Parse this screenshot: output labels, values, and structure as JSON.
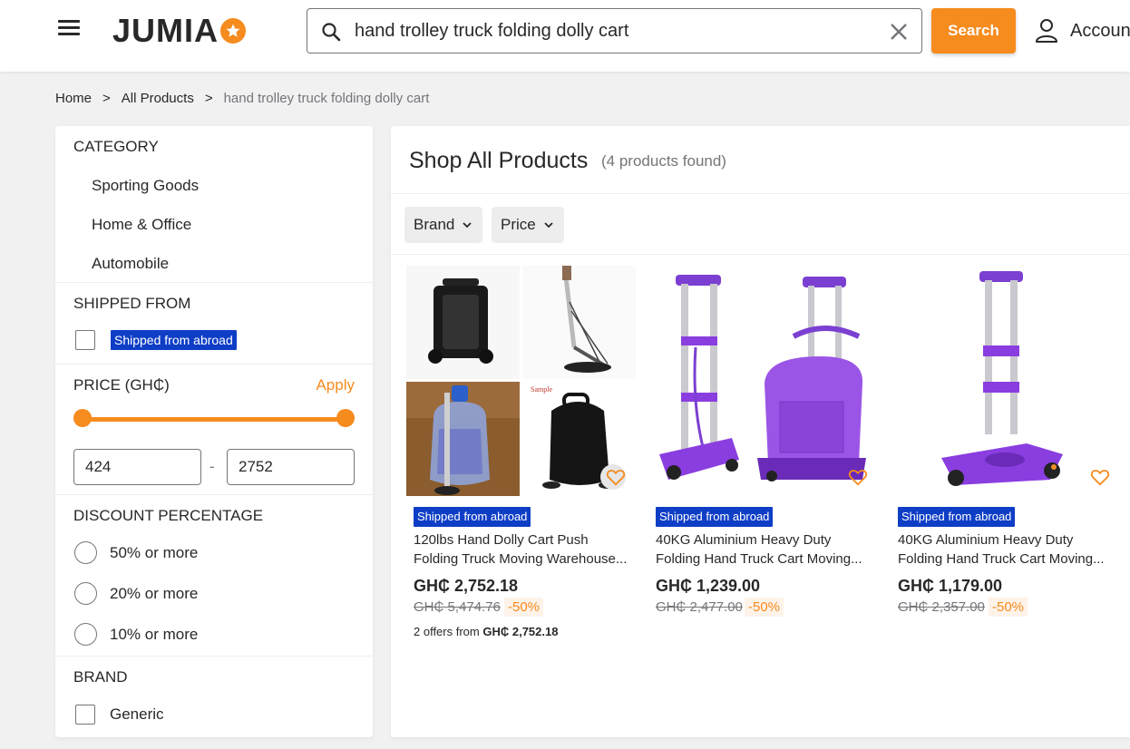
{
  "header": {
    "logo_text": "JUMIA",
    "search_value": "hand trolley truck folding dolly cart",
    "search_button": "Search",
    "account_label": "Accoun"
  },
  "breadcrumb": {
    "home": "Home",
    "all_products": "All Products",
    "current": "hand trolley truck folding dolly cart",
    "separator": ">"
  },
  "sidebar": {
    "category": {
      "title": "CATEGORY",
      "items": [
        "Sporting Goods",
        "Home & Office",
        "Automobile"
      ]
    },
    "shipped_from": {
      "title": "SHIPPED FROM",
      "option": "Shipped from abroad"
    },
    "price": {
      "title": "PRICE (GH₵)",
      "apply": "Apply",
      "min": "424",
      "max": "2752",
      "dash": "-"
    },
    "discount": {
      "title": "DISCOUNT PERCENTAGE",
      "options": [
        "50% or more",
        "20% or more",
        "10% or more"
      ]
    },
    "brand": {
      "title": "BRAND",
      "options": [
        "Generic"
      ]
    }
  },
  "main": {
    "title": "Shop All Products",
    "count": "(4 products found)",
    "filters": [
      "Brand",
      "Price"
    ],
    "products": [
      {
        "badge": "Shipped from abroad",
        "name_line1": "120lbs Hand Dolly Cart Push",
        "name_line2": "Folding Truck Moving Warehouse...",
        "price": "GH₵ 2,752.18",
        "old_price": "GH₵ 5,474.76",
        "discount": "-50%",
        "offers_prefix": "2 offers from",
        "offers_price": "GH₵ 2,752.18"
      },
      {
        "badge": "Shipped from abroad",
        "name_line1": "40KG Aluminium Heavy Duty",
        "name_line2": "Folding Hand Truck Cart Moving...",
        "price": "GH₵ 1,239.00",
        "old_price": "GH₵ 2,477.00",
        "discount": "-50%"
      },
      {
        "badge": "Shipped from abroad",
        "name_line1": "40KG Aluminium Heavy Duty",
        "name_line2": "Folding Hand Truck Cart Moving...",
        "price": "GH₵ 1,179.00",
        "old_price": "GH₵ 2,357.00",
        "discount": "-50%"
      }
    ],
    "sample_label": "Sample"
  },
  "colors": {
    "accent": "#f68b1e",
    "badge_blue": "#0f3ec6",
    "purple_product": "#8a3ee0"
  }
}
